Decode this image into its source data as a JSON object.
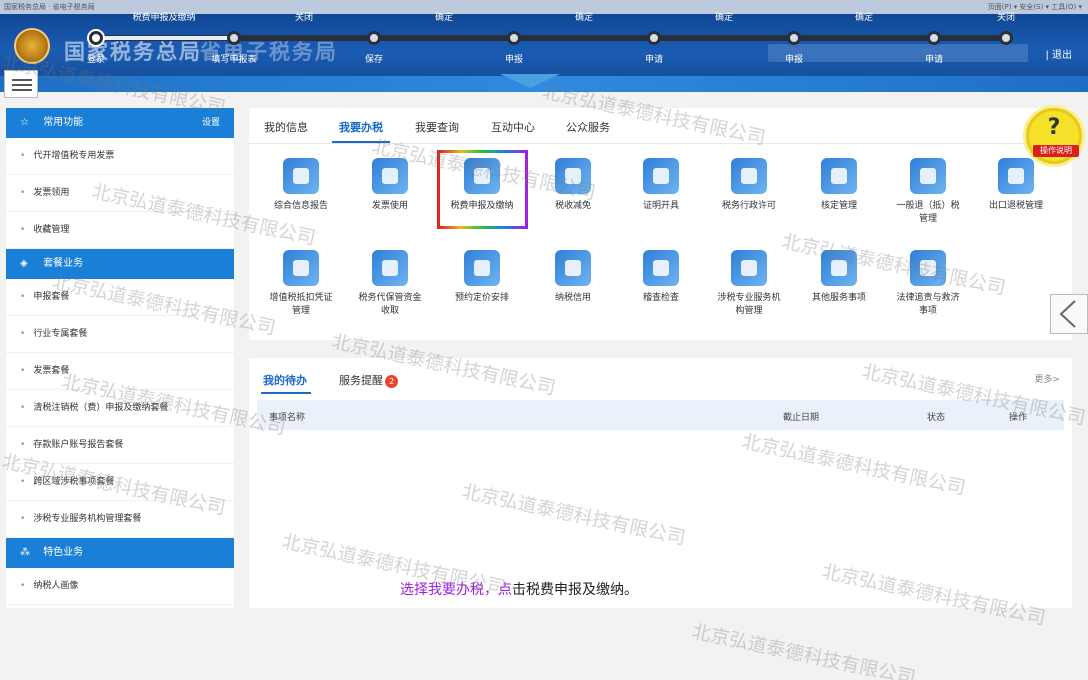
{
  "browser": {
    "tab_text": "国家税务总局 · 省电子税务局",
    "right_text": "页面(P) ▾  安全(S) ▾  工具(O) ▾"
  },
  "header": {
    "title_left": "国家税务总局",
    "title_right": "省电子税务局",
    "exit_label": "| 退出"
  },
  "steps": {
    "top_labels": [
      "税费申报及缴纳",
      "关闭",
      "确定",
      "确定",
      "确定",
      "确定",
      "关闭"
    ],
    "bottom_labels": [
      "登录",
      "填写申报表",
      "保存",
      "申报",
      "申请",
      "申报",
      "申请"
    ]
  },
  "sidebar": {
    "sections": [
      {
        "title": "常用功能",
        "setting": "设置",
        "icon": "star-icon",
        "items": [
          "代开增值税专用发票",
          "发票领用",
          "收藏管理"
        ]
      },
      {
        "title": "套餐业务",
        "icon": "layers-icon",
        "items": [
          "申报套餐",
          "行业专属套餐",
          "发票套餐",
          "清税注销税（费）申报及缴纳套餐",
          "存款账户账号报告套餐",
          "跨区域涉税事项套餐",
          "涉税专业服务机构管理套餐"
        ]
      },
      {
        "title": "特色业务",
        "icon": "grid-icon",
        "items": [
          "纳税人画像"
        ]
      }
    ]
  },
  "tabs": [
    "我的信息",
    "我要办税",
    "我要查询",
    "互动中心",
    "公众服务"
  ],
  "active_tab": "我要办税",
  "services_row1": [
    {
      "label": "综合信息报告",
      "icon": "report-icon",
      "color": "#2f7fd8"
    },
    {
      "label": "发票使用",
      "icon": "invoice-icon",
      "color": "#2f7fd8"
    },
    {
      "label": "税费申报及缴纳",
      "icon": "tax-declare-icon",
      "color": "#2f7fd8"
    },
    {
      "label": "税收减免",
      "icon": "tax-relief-icon",
      "color": "#2f7fd8"
    },
    {
      "label": "证明开具",
      "icon": "certificate-icon",
      "color": "#2f7fd8"
    },
    {
      "label": "税务行政许可",
      "icon": "permit-icon",
      "color": "#2f7fd8"
    },
    {
      "label": "核定管理",
      "icon": "verify-icon",
      "color": "#2f7fd8"
    },
    {
      "label": "一般退（抵）税",
      "label2": "管理",
      "icon": "refund-icon",
      "color": "#2f7fd8"
    },
    {
      "label": "出口退税管理",
      "icon": "export-refund-icon",
      "color": "#2f7fd8"
    }
  ],
  "services_row2": [
    {
      "label": "增值税抵扣凭证",
      "label2": "管理",
      "icon": "deduction-icon",
      "color": "#2f7fd8"
    },
    {
      "label": "税务代保管资金",
      "label2": "收取",
      "icon": "custody-icon",
      "color": "#2f7fd8"
    },
    {
      "label": "预约定价安排",
      "icon": "pricing-icon",
      "color": "#2f7fd8"
    },
    {
      "label": "纳税信用",
      "icon": "credit-icon",
      "color": "#2f7fd8"
    },
    {
      "label": "稽查检查",
      "icon": "audit-icon",
      "color": "#2f7fd8"
    },
    {
      "label": "涉税专业服务机",
      "label2": "构管理",
      "icon": "agency-icon",
      "color": "#2f7fd8"
    },
    {
      "label": "其他服务事项",
      "icon": "other-icon",
      "color": "#2f7fd8"
    },
    {
      "label": "法律追责与救济",
      "label2": "事项",
      "icon": "law-icon",
      "color": "#2f7fd8"
    }
  ],
  "todo": {
    "tab_active": "我的待办",
    "tab_other": "服务提醒",
    "badge_count": "2",
    "more": "更多>",
    "columns": [
      "事项名称",
      "截止日期",
      "状态",
      "操作"
    ]
  },
  "caption": {
    "part1": "选择我要办税，",
    "part2": "点",
    "part3": "击税费申报及缴纳。"
  },
  "help": {
    "symbol": "?",
    "label": "操作说明"
  },
  "watermark": "北京弘道泰德科技有限公司"
}
